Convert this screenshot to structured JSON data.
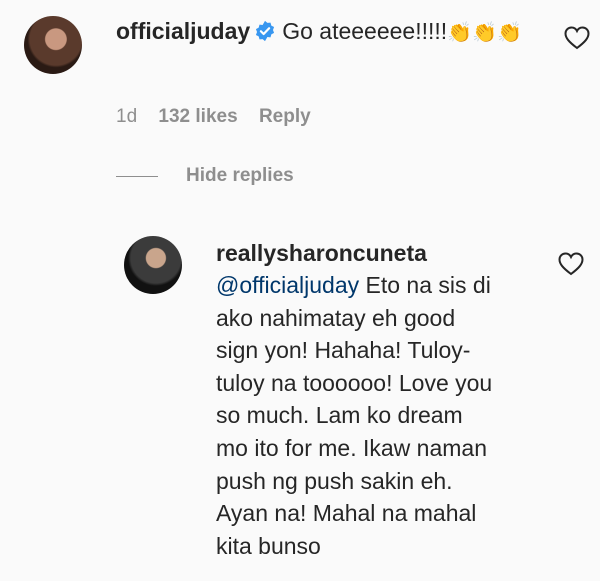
{
  "comment": {
    "username": "officialjuday",
    "text": "Go ateeeeee!!!!!",
    "emoji": "👏👏👏",
    "time": "1d",
    "likes": "132 likes",
    "reply_label": "Reply",
    "icons": {
      "verified": "verified-badge-icon",
      "like": "heart-icon"
    },
    "colors": {
      "verified": "#3897f0",
      "meta": "#8e8e8e"
    }
  },
  "replies_toggle": {
    "label": "Hide replies"
  },
  "reply": {
    "username": "reallysharoncuneta",
    "mention": "@officialjuday",
    "text": " Eto na sis di\nako nahimatay eh good\nsign yon! Hahaha! Tuloy-\ntuloy na toooooo! Love you\nso much. Lam ko dream\nmo ito for me. Ikaw naman\npush ng push sakin eh.\nAyan na! Mahal na mahal\nkita bunso",
    "icons": {
      "like": "heart-icon"
    },
    "colors": {
      "mention": "#00376b"
    }
  }
}
